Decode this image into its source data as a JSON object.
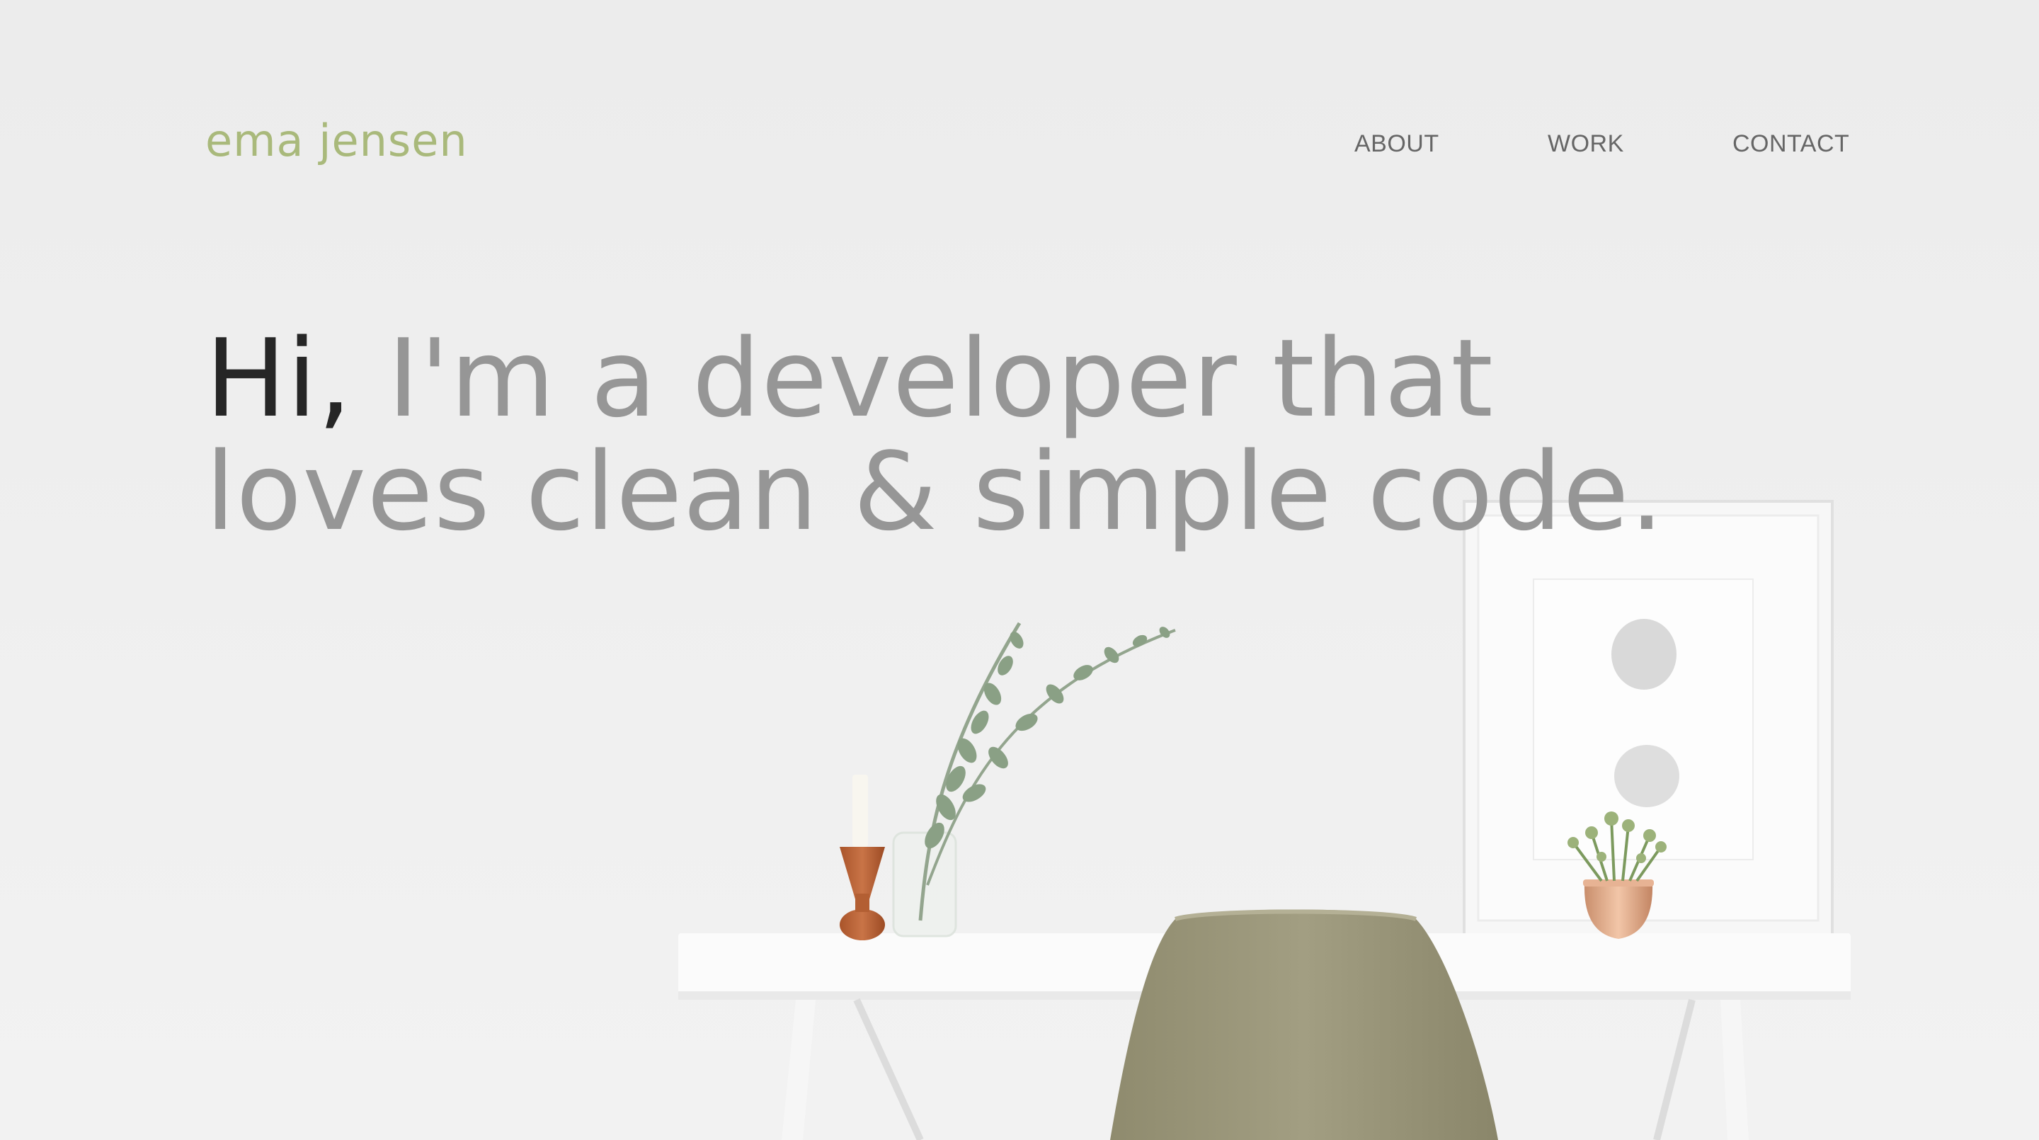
{
  "brand": {
    "name": "ema jensen",
    "color": "#a9b97b"
  },
  "nav": {
    "items": [
      {
        "label": "ABOUT"
      },
      {
        "label": "WORK"
      },
      {
        "label": "CONTACT"
      }
    ]
  },
  "hero": {
    "greeting": "Hi,",
    "line1_rest": "I'm a developer that",
    "line2": "loves clean & simple code.",
    "greeting_color": "#262626",
    "text_color": "#969696"
  },
  "background": {
    "description_icons": [
      "plant-icon",
      "candle-icon",
      "frame-icon",
      "chair-icon",
      "desk-icon"
    ],
    "wall_color": "#efefef"
  }
}
